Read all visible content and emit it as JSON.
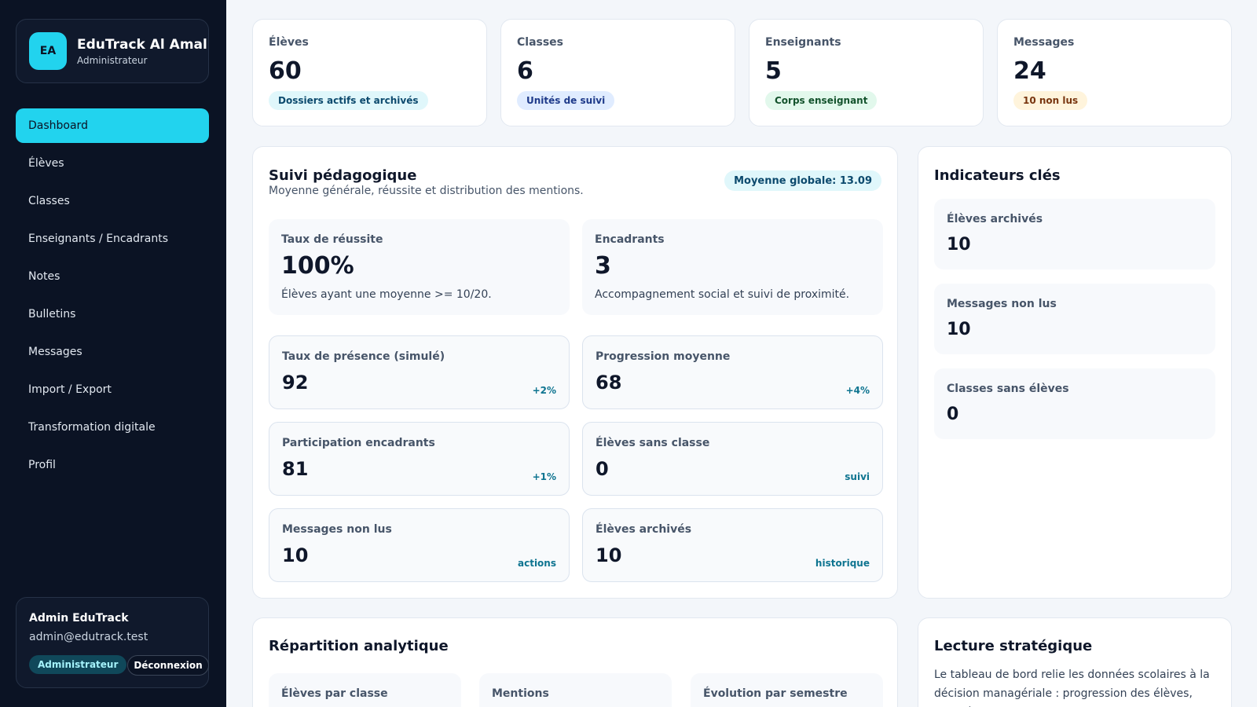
{
  "brand": {
    "initials": "EA",
    "name": "EduTrack Al Amal",
    "role": "Administrateur"
  },
  "nav": {
    "items": [
      {
        "label": "Dashboard"
      },
      {
        "label": "Élèves"
      },
      {
        "label": "Classes"
      },
      {
        "label": "Enseignants / Encadrants"
      },
      {
        "label": "Notes"
      },
      {
        "label": "Bulletins"
      },
      {
        "label": "Messages"
      },
      {
        "label": "Import / Export"
      },
      {
        "label": "Transformation digitale"
      },
      {
        "label": "Profil"
      }
    ],
    "active": "Dashboard"
  },
  "user": {
    "name": "Admin EduTrack",
    "email": "admin@edutrack.test",
    "role_badge": "Administrateur",
    "logout_label": "Déconnexion"
  },
  "stats": [
    {
      "label": "Élèves",
      "value": "60",
      "badge": "Dossiers actifs et archivés"
    },
    {
      "label": "Classes",
      "value": "6",
      "badge": "Unités de suivi"
    },
    {
      "label": "Enseignants",
      "value": "5",
      "badge": "Corps enseignant"
    },
    {
      "label": "Messages",
      "value": "24",
      "badge": "10 non lus"
    }
  ],
  "suivi": {
    "title": "Suivi pédagogique",
    "subtitle": "Moyenne générale, réussite et distribution des mentions.",
    "global_badge": "Moyenne globale: 13.09",
    "highlights": [
      {
        "label": "Taux de réussite",
        "value": "100%",
        "desc": "Élèves ayant une moyenne >= 10/20."
      },
      {
        "label": "Encadrants",
        "value": "3",
        "desc": "Accompagnement social et suivi de proximité."
      }
    ],
    "metrics": [
      {
        "label": "Taux de présence (simulé)",
        "value": "92",
        "tag": "+2%"
      },
      {
        "label": "Progression moyenne",
        "value": "68",
        "tag": "+4%"
      },
      {
        "label": "Participation encadrants",
        "value": "81",
        "tag": "+1%"
      },
      {
        "label": "Élèves sans classe",
        "value": "0",
        "tag": "suivi"
      },
      {
        "label": "Messages non lus",
        "value": "10",
        "tag": "actions"
      },
      {
        "label": "Élèves archivés",
        "value": "10",
        "tag": "historique"
      }
    ]
  },
  "indicateurs": {
    "title": "Indicateurs clés",
    "items": [
      {
        "label": "Élèves archivés",
        "value": "10"
      },
      {
        "label": "Messages non lus",
        "value": "10"
      },
      {
        "label": "Classes sans élèves",
        "value": "0"
      }
    ]
  },
  "repartition": {
    "title": "Répartition analytique",
    "cards": [
      {
        "label": "Élèves par classe"
      },
      {
        "label": "Mentions"
      },
      {
        "label": "Évolution par semestre"
      }
    ]
  },
  "strategie": {
    "title": "Lecture stratégique",
    "text": "Le tableau de bord relie les données scolaires à la décision managériale : progression des élèves, qualité"
  },
  "colors": {
    "sidebar": "#0b1324",
    "accent": "#22d3ee",
    "background": "#f3f6fa"
  }
}
